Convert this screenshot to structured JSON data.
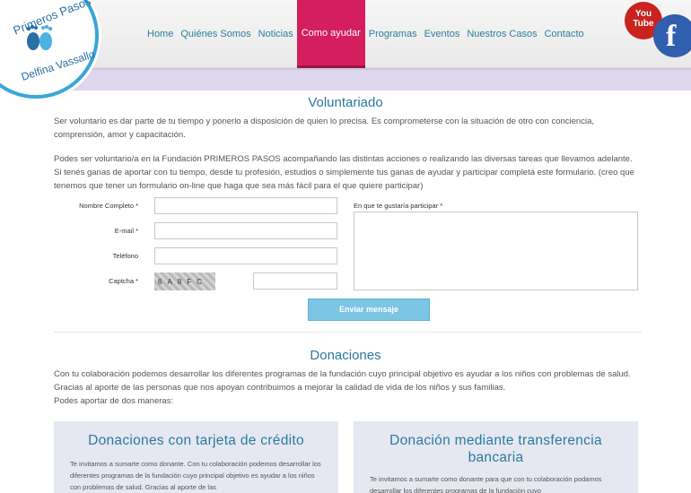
{
  "logo": {
    "title": "Primeros Pasos",
    "subtitle": "Delfina Vassallo"
  },
  "nav": [
    {
      "label": "Home"
    },
    {
      "label": "Quiénes Somos"
    },
    {
      "label": "Noticias"
    },
    {
      "label": "Como ayudar",
      "active": true
    },
    {
      "label": "Programas"
    },
    {
      "label": "Eventos"
    },
    {
      "label": "Nuestros Casos"
    },
    {
      "label": "Contacto"
    }
  ],
  "social": {
    "youtube_label_1": "You",
    "youtube_label_2": "Tube",
    "facebook_label": "f"
  },
  "voluntariado": {
    "title": "Voluntariado",
    "p1": "Ser voluntario es dar parte de tu tiempo y ponerlo a disposición de quien lo precisa. Es comprometerse con la situación de otro con conciencia, comprensión, amor y capacitación.",
    "p2": "Podes ser voluntario/a en la Fundación PRIMEROS PASOS acompañando las distintas acciones o realizando las diversas tareas que llevamos adelante. Si tenés ganas de aportar con tu tiempo, desde tu profesión, estudios o simplemente tus ganas de ayudar y participar completá este formulario. (creo que tenemos que tener un formulario on-line que haga que sea más fácil para el que quiere participar)"
  },
  "form": {
    "name_label": "Nombre Completo *",
    "email_label": "E-mail *",
    "phone_label": "Teléfono",
    "captcha_label": "Captcha *",
    "captcha_text": "6A8FC",
    "participate_label": "En que te gustaría participar *",
    "name_value": "",
    "email_value": "",
    "phone_value": "",
    "captcha_value": "",
    "participate_value": "",
    "submit_label": "Enviar mensaje"
  },
  "donaciones": {
    "title": "Donaciones",
    "p1": "Con tu colaboración podemos desarrollar los diferentes programas de la fundación cuyo principal objetivo es ayudar a los niños con problemas de salud.",
    "p2": "Gracias al aporte de las personas que nos apoyan contribuimos a mejorar la calidad de vida de los niños y sus familias.",
    "p3": "Podes aportar de dos maneras:",
    "card1": {
      "title": "Donaciones con tarjeta de crédito",
      "text": "Te invitamos a sumarte como donante. Con tu colaboración podemos desarrollar los diferentes programas de la fundación cuyo principal objetivo es ayudar a los niños con problemas de salud. Gracias al aporte de las"
    },
    "card2": {
      "title": "Donación mediante transferencia bancaria",
      "text": "Te invitamos a sumarte como donante para que con tu colaboración podamos desarrollar los diferentes programas de la fundación cuyo"
    }
  }
}
